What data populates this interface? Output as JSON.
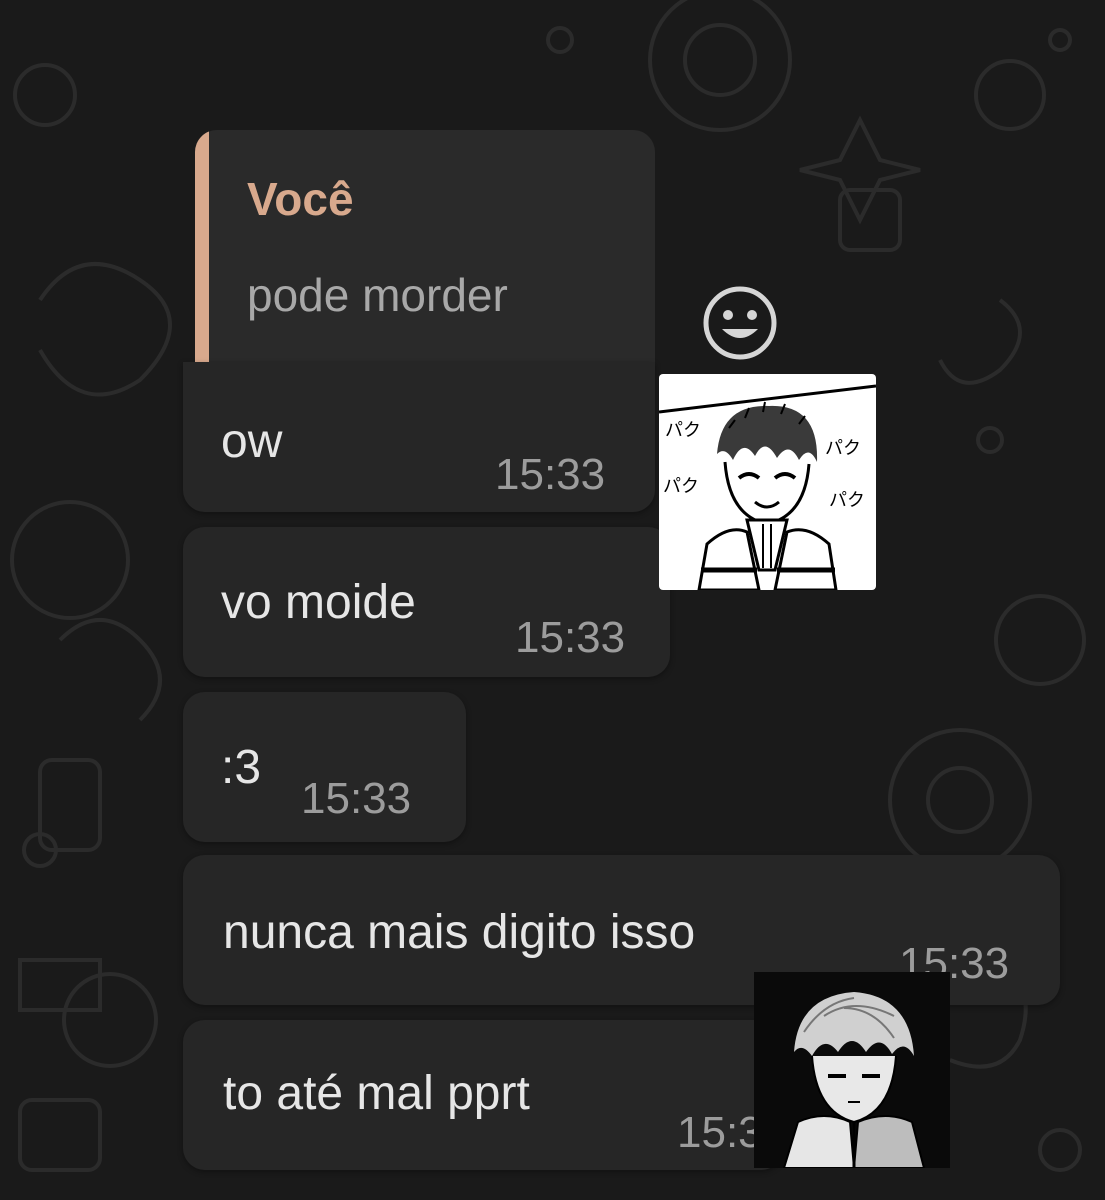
{
  "colors": {
    "background": "#1a1a1a",
    "bubble": "#262626",
    "reply_accent": "#d8a98d",
    "text": "#e6e6e6",
    "time": "#9c9c9c"
  },
  "reply": {
    "author": "Você",
    "text": "pode morder"
  },
  "messages": [
    {
      "text": "ow",
      "time": "15:33"
    },
    {
      "text": "vo moide",
      "time": "15:33"
    },
    {
      "text": ":3",
      "time": "15:33"
    },
    {
      "text": "nunca mais digito isso",
      "time": "15:33"
    },
    {
      "text": "to até mal pprt",
      "time": "15:33"
    }
  ],
  "icons": {
    "react": "smiley-face-icon"
  },
  "stickers": [
    {
      "name": "manga-boy-smiling-sticker",
      "text": [
        "パク",
        "パク",
        "パク",
        "パク"
      ]
    },
    {
      "name": "manga-boy-portrait-sticker"
    }
  ]
}
